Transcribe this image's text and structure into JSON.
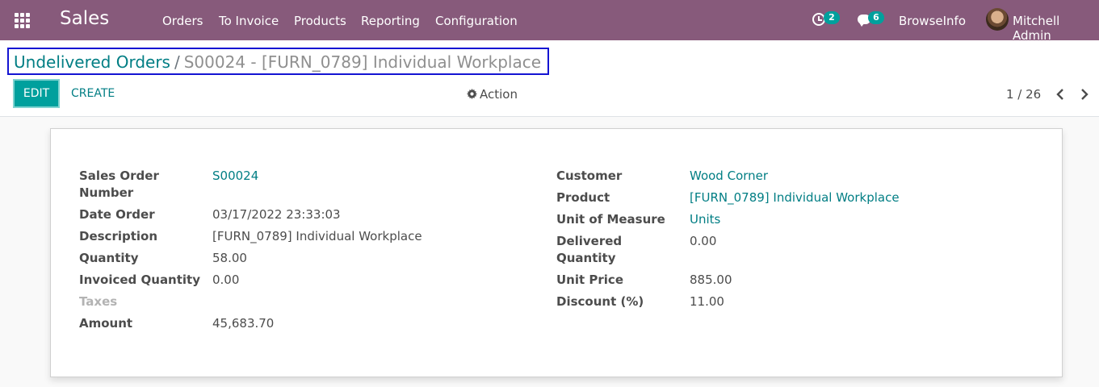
{
  "app": {
    "title": "Sales"
  },
  "menu": [
    "Orders",
    "To Invoice",
    "Products",
    "Reporting",
    "Configuration"
  ],
  "systray": {
    "activity_count": "2",
    "message_count": "6",
    "company": "BrowseInfo",
    "user": "Mitchell Admin"
  },
  "breadcrumb": {
    "parent": "Undelivered Orders",
    "separator": "/",
    "current": "S00024 - [FURN_0789] Individual Workplace"
  },
  "toolbar": {
    "edit_label": "EDIT",
    "create_label": "CREATE",
    "action_label": "Action"
  },
  "pager": {
    "value": "1 / 26"
  },
  "form": {
    "left": [
      {
        "label": "Sales Order",
        "label2": "Number",
        "value": "S00024"
      },
      {
        "label": "Date Order",
        "value": "03/17/2022 23:33:03"
      },
      {
        "label": "Description",
        "value": "[FURN_0789] Individual Workplace"
      },
      {
        "label": "Quantity",
        "value": "58.00"
      },
      {
        "label": "Invoiced Quantity",
        "value": "0.00"
      },
      {
        "label": "Taxes",
        "value": ""
      },
      {
        "label": "Amount",
        "value": "45,683.70"
      }
    ],
    "right": [
      {
        "label": "Customer",
        "value": "Wood Corner"
      },
      {
        "label": "Product",
        "value": "[FURN_0789] Individual Workplace"
      },
      {
        "label": "Unit of Measure",
        "value": "Units"
      },
      {
        "label": "Delivered",
        "label2": "Quantity",
        "value": "0.00"
      },
      {
        "label": "Unit Price",
        "value": "885.00"
      },
      {
        "label": "Discount (%)",
        "value": "11.00"
      }
    ]
  },
  "colors": {
    "navbar": "#875a7b",
    "accent": "#00a09d",
    "link": "#017e84",
    "highlight_box": "#1414d2"
  }
}
